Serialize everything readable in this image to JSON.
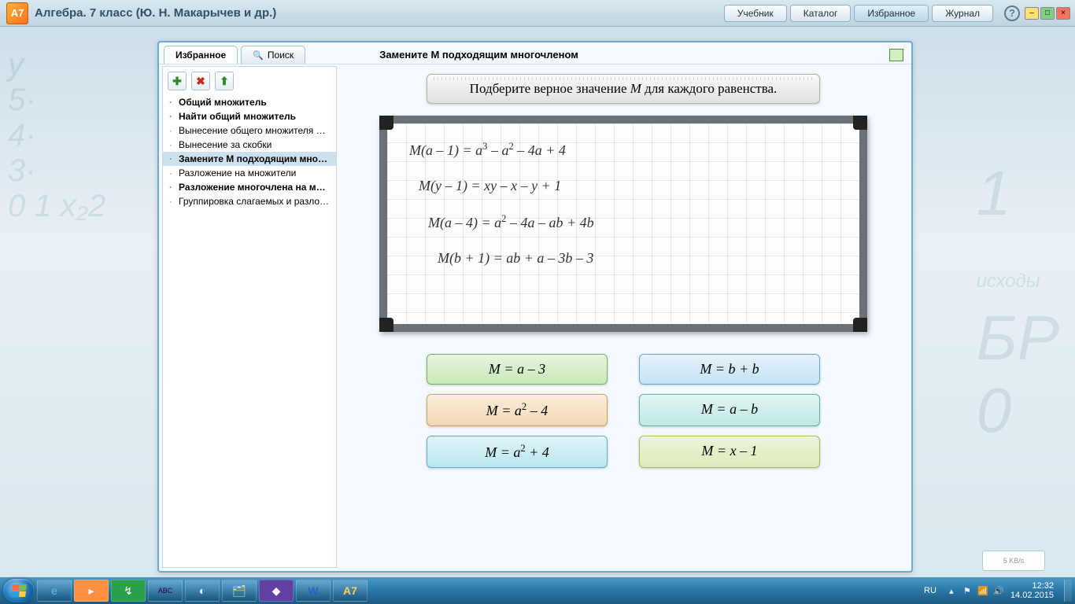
{
  "titlebar": {
    "app_icon_text": "A7",
    "title": "Алгебра. 7 класс (Ю. Н. Макарычев и др.)",
    "tabs": [
      "Учебник",
      "Каталог",
      "Избранное",
      "Журнал"
    ],
    "active_tab_index": 2,
    "help": "?"
  },
  "panel": {
    "tabs": {
      "favorites": "Избранное",
      "search": "Поиск"
    },
    "topic_title": "Замените M подходящим многочленом"
  },
  "sidebar": {
    "items": [
      "Общий множитель",
      "Найти общий множитель",
      "Вынесение общего множителя за ...",
      "Вынесение за скобки",
      "Замените M подходящим многоч...",
      "Разложение на множители",
      "Разложение многочлена на множ...",
      "Группировка слагаемых и разлож..."
    ],
    "bold_indices": [
      0,
      1,
      4,
      6
    ],
    "selected_index": 4
  },
  "content": {
    "prompt_html": "Подберите верное значение <i>M</i> для каждого равенства.",
    "equations": [
      "M(a – 1) = a<sup>3</sup> – a<sup>2</sup> – 4a + 4",
      "M(y – 1) = xy – x – y + 1",
      "M(a – 4) = a<sup>2</sup> – 4a – ab + 4b",
      "M(b + 1) = ab + a – 3b – 3"
    ],
    "answers": [
      {
        "label_html": "M = a – 3",
        "cls": "ans-green"
      },
      {
        "label_html": "M = b + b",
        "cls": "ans-blue"
      },
      {
        "label_html": "M = a<sup>2</sup> – 4",
        "cls": "ans-orange"
      },
      {
        "label_html": "M = a – b",
        "cls": "ans-teal"
      },
      {
        "label_html": "M = a<sup>2</sup> + 4",
        "cls": "ans-cyan"
      },
      {
        "label_html": "M = x – 1",
        "cls": "ans-olive"
      }
    ]
  },
  "net_indicator": "5 KB/s",
  "taskbar": {
    "lang": "RU",
    "time": "12:32",
    "date": "14.02.2015"
  }
}
